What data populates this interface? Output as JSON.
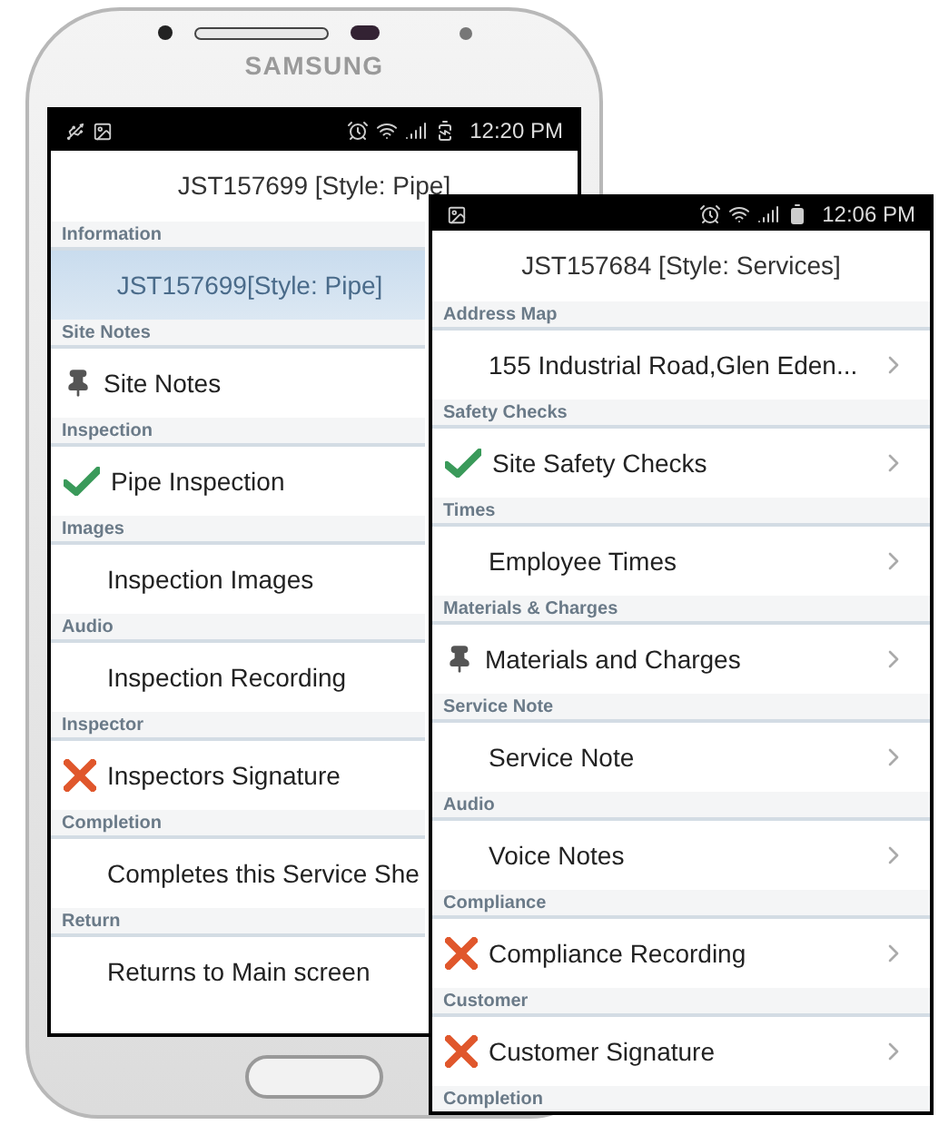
{
  "device": {
    "brand": "SAMSUNG"
  },
  "screens": [
    {
      "status_bar": {
        "time": "12:20 PM",
        "usb": true,
        "charging": true
      },
      "title": "JST157699 [Style: Pipe]",
      "sections": [
        {
          "header": "Information",
          "item": {
            "label": "JST157699[Style: Pipe]",
            "kind": "heading",
            "selected": true
          }
        },
        {
          "header": "Site Notes",
          "item": {
            "label": "Site Notes",
            "kind": "pin",
            "selected": false
          }
        },
        {
          "header": "Inspection",
          "item": {
            "label": "Pipe Inspection",
            "kind": "check",
            "selected": false
          }
        },
        {
          "header": "Images",
          "item": {
            "label": "Inspection Images",
            "kind": "plain",
            "selected": false
          }
        },
        {
          "header": "Audio",
          "item": {
            "label": "Inspection Recording",
            "kind": "plain",
            "selected": false
          }
        },
        {
          "header": "Inspector",
          "item": {
            "label": "Inspectors Signature",
            "kind": "cross",
            "selected": false
          }
        },
        {
          "header": "Completion",
          "item": {
            "label": "Completes this Service She",
            "kind": "plain",
            "selected": false
          }
        },
        {
          "header": "Return",
          "item": {
            "label": "Returns to Main screen",
            "kind": "plain",
            "selected": false
          }
        }
      ]
    },
    {
      "status_bar": {
        "time": "12:06 PM",
        "usb": false,
        "charging": false
      },
      "title": "JST157684 [Style: Services]",
      "sections": [
        {
          "header": "Address Map",
          "item": {
            "label": "155 Industrial Road,Glen Eden...",
            "kind": "plain",
            "selected": false
          }
        },
        {
          "header": "Safety Checks",
          "item": {
            "label": "Site Safety Checks",
            "kind": "check",
            "selected": false
          }
        },
        {
          "header": "Times",
          "item": {
            "label": "Employee Times",
            "kind": "plain",
            "selected": false
          }
        },
        {
          "header": "Materials & Charges",
          "item": {
            "label": "Materials and Charges",
            "kind": "pin",
            "selected": false
          }
        },
        {
          "header": "Service Note",
          "item": {
            "label": "Service Note",
            "kind": "plain",
            "selected": false
          }
        },
        {
          "header": "Audio",
          "item": {
            "label": "Voice Notes",
            "kind": "plain",
            "selected": false
          }
        },
        {
          "header": "Compliance",
          "item": {
            "label": "Compliance Recording",
            "kind": "cross",
            "selected": false
          }
        },
        {
          "header": "Customer",
          "item": {
            "label": "Customer Signature",
            "kind": "cross",
            "selected": false
          }
        },
        {
          "header": "Completion"
        }
      ]
    }
  ]
}
